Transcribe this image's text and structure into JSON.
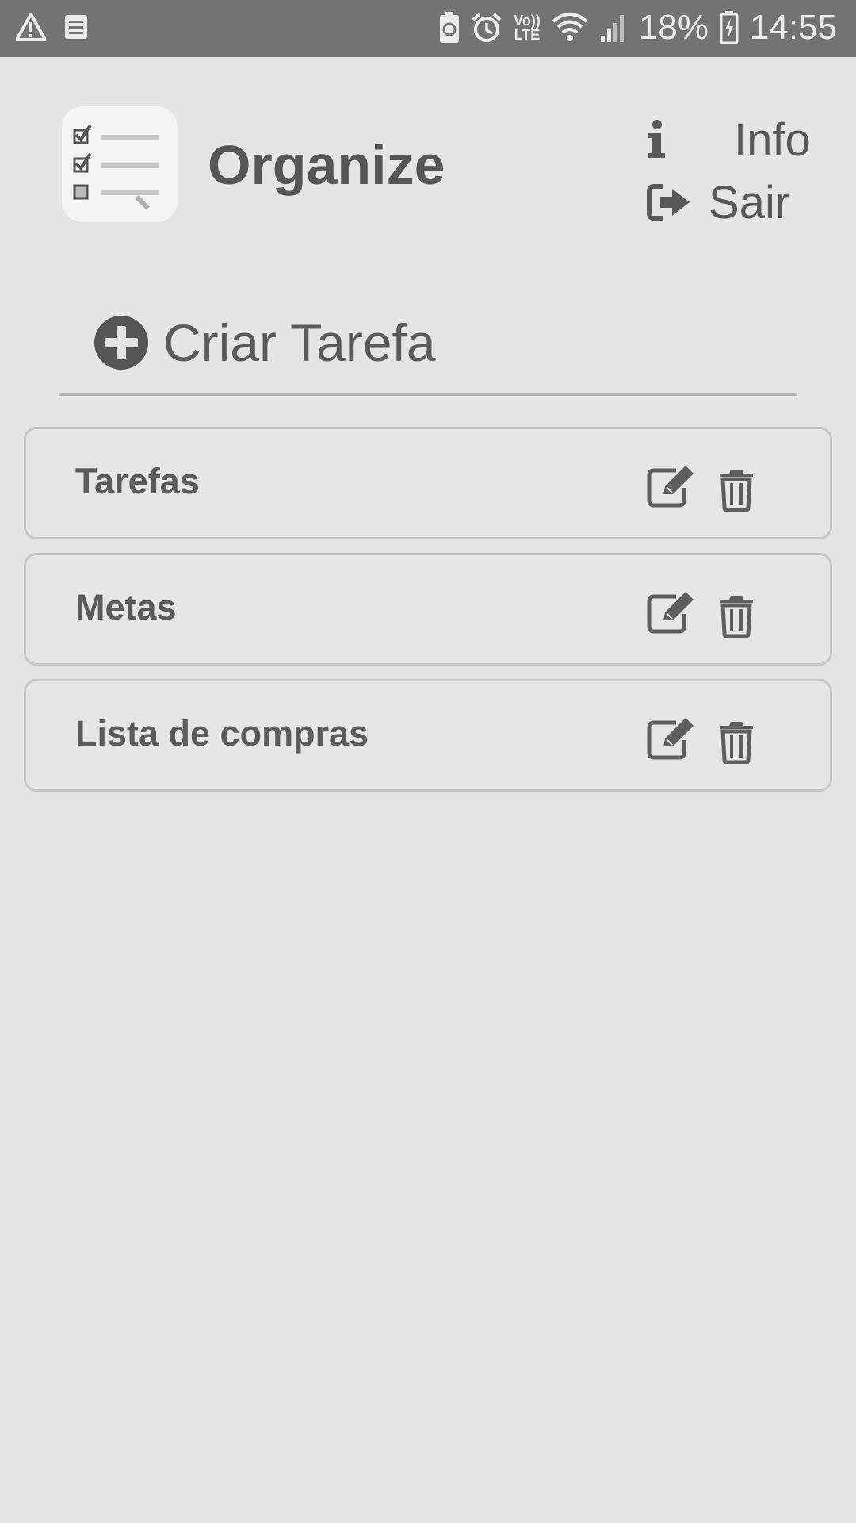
{
  "status_bar": {
    "battery_percent": "18%",
    "time": "14:55",
    "lte_top": "Vo))",
    "lte_bottom": "LTE",
    "icons": [
      "warning-icon",
      "notes-icon",
      "battery-saver-icon",
      "alarm-icon",
      "volte-icon",
      "wifi-icon",
      "signal-icon",
      "battery-charging-icon"
    ]
  },
  "header": {
    "app_title": "Organize",
    "info_label": "Info",
    "logout_label": "Sair"
  },
  "create": {
    "label": "Criar Tarefa"
  },
  "lists": [
    {
      "title": "Tarefas"
    },
    {
      "title": "Metas"
    },
    {
      "title": "Lista de compras"
    }
  ],
  "colors": {
    "background": "#e5e5e6",
    "status_bar": "#737373",
    "text": "#5b5b5b",
    "border": "#c6c6c6"
  }
}
